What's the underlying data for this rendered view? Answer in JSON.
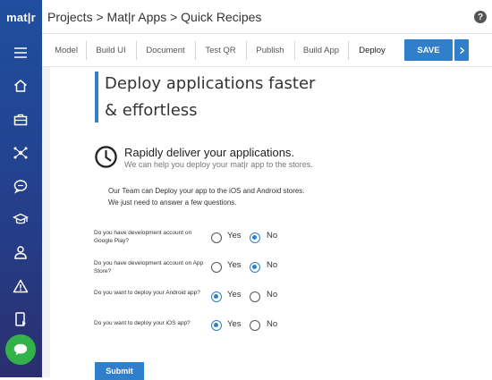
{
  "app": {
    "logo": "mat|r"
  },
  "header": {
    "breadcrumb": "Projects > Mat|r Apps > Quick Recipes",
    "help": "?"
  },
  "tabs": [
    {
      "label": "Model"
    },
    {
      "label": "Build UI"
    },
    {
      "label": "Document"
    },
    {
      "label": "Test QR"
    },
    {
      "label": "Publish"
    },
    {
      "label": "Build App"
    },
    {
      "label": "Deploy",
      "active": true
    }
  ],
  "toolbar": {
    "save_label": "SAVE"
  },
  "hero": {
    "line1": "Deploy applications faster",
    "line2": "& effortless"
  },
  "intro": {
    "title": "Rapidly deliver your applications.",
    "subtitle": "We can help you deploy your mat|r app to the stores.",
    "para1": "Our Team can Deploy your app to the iOS and Android stores.",
    "para2": "We just need to answer a few questions."
  },
  "questions": [
    {
      "text": "Do you have development account on Google Play?",
      "yes": "Yes",
      "no": "No",
      "selected": "no"
    },
    {
      "text": "Do you have development account on App Store?",
      "yes": "Yes",
      "no": "No",
      "selected": "no"
    },
    {
      "text": "Do you want to deploy your Android app?",
      "yes": "Yes",
      "no": "No",
      "selected": "yes"
    },
    {
      "text": "Do you want to deploy your iOS app?",
      "yes": "Yes",
      "no": "No",
      "selected": "yes"
    }
  ],
  "form": {
    "submit_label": "Submit"
  },
  "colors": {
    "accent": "#2f7fcb",
    "sidebar": "#243f8c",
    "chat": "#33b249"
  }
}
